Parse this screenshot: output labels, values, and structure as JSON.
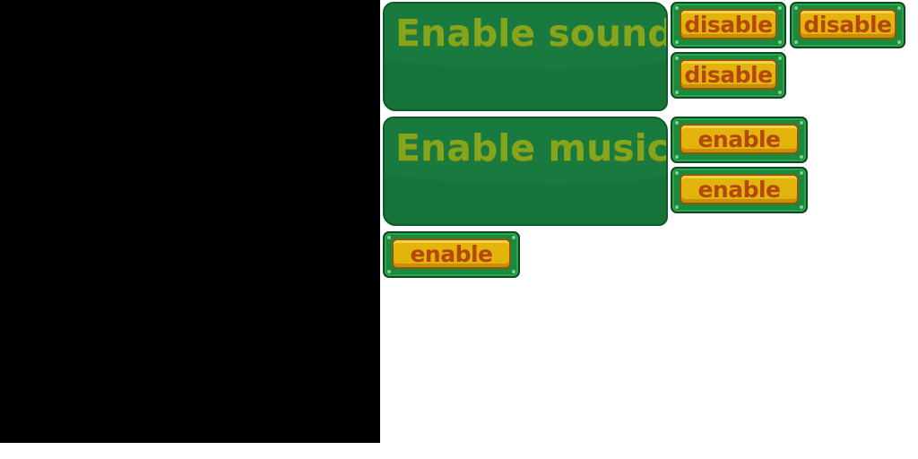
{
  "panels": {
    "sound": {
      "title": "Enable sound?"
    },
    "music": {
      "title": "Enable music?"
    }
  },
  "buttons": {
    "disable_1": "disable",
    "disable_2": "disable",
    "disable_3": "disable",
    "enable_1": "enable",
    "enable_2": "enable",
    "enable_3": "enable"
  },
  "colors": {
    "panel_green": "#16733a",
    "title_olive": "#86a51c",
    "button_frame_green": "#1c8a3c",
    "button_face_yellow": "#e3b40c",
    "button_text_orange": "#b4470e"
  }
}
